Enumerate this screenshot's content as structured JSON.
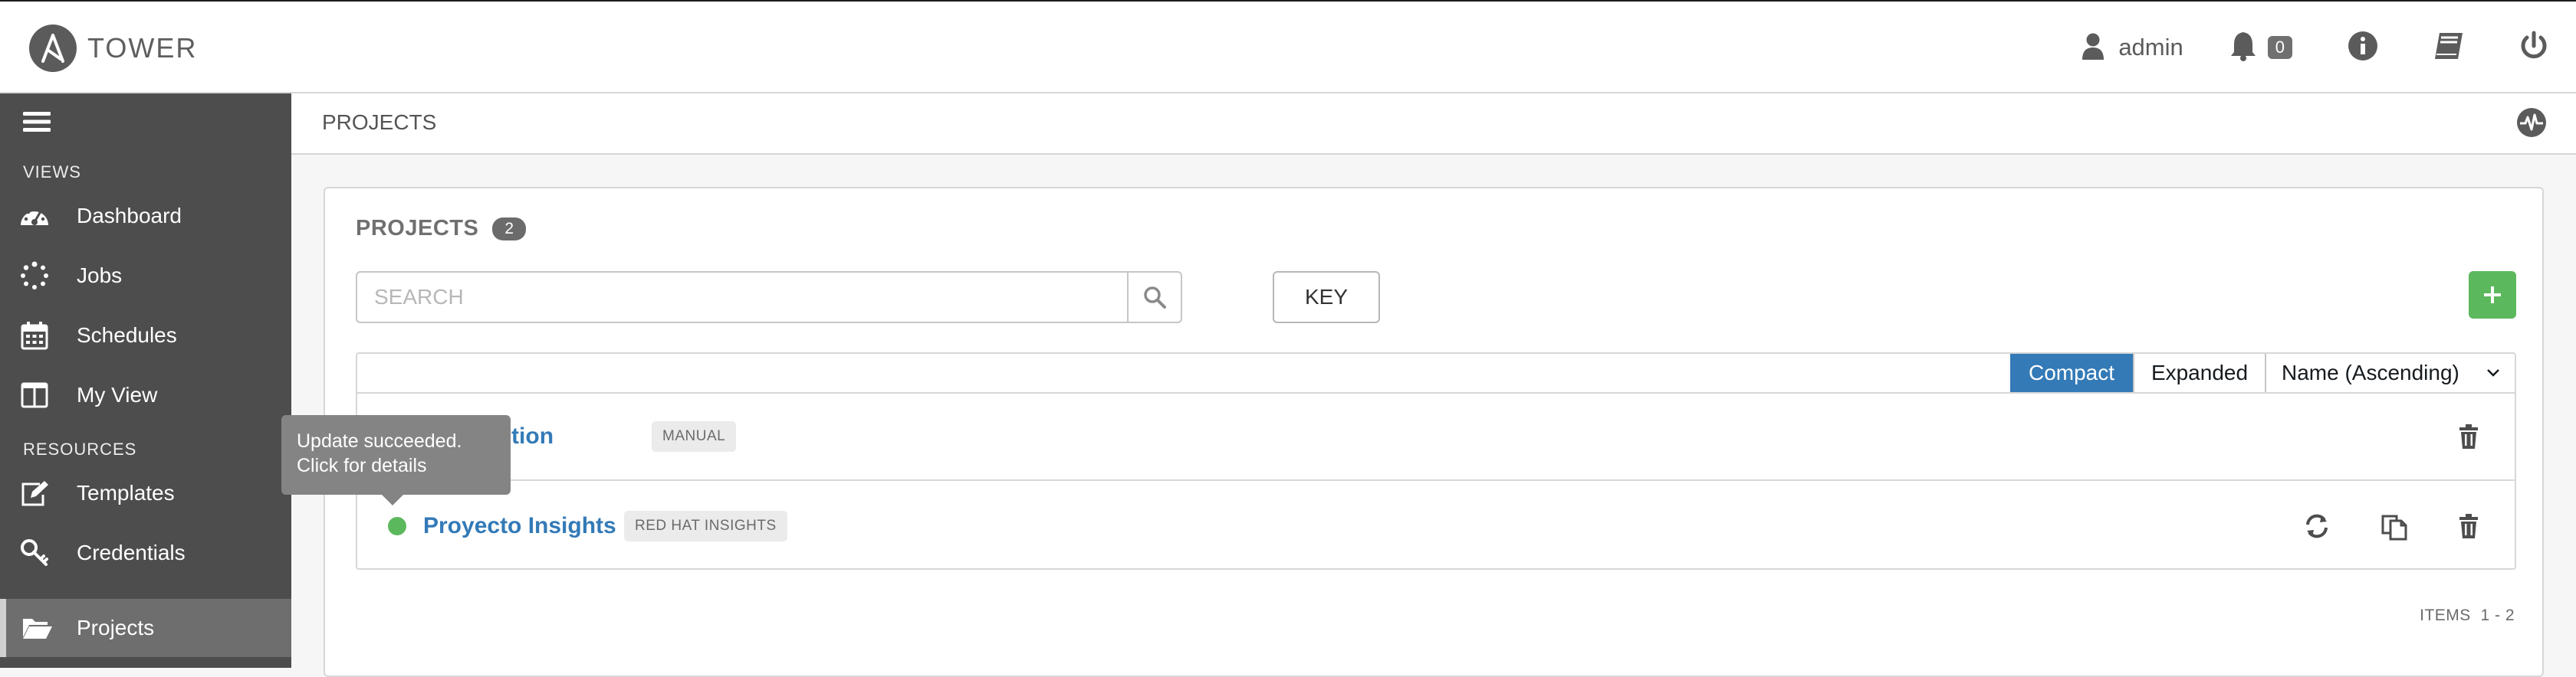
{
  "app": {
    "logo_text": "TOWER"
  },
  "header": {
    "user_label": "admin",
    "notifications_count": "0"
  },
  "sidebar": {
    "sections": {
      "views": "VIEWS",
      "resources": "RESOURCES"
    },
    "items": [
      {
        "label": "Dashboard",
        "icon": "dashboard-icon"
      },
      {
        "label": "Jobs",
        "icon": "spinner-icon"
      },
      {
        "label": "Schedules",
        "icon": "calendar-icon"
      },
      {
        "label": "My View",
        "icon": "columns-icon"
      },
      {
        "label": "Templates",
        "icon": "edit-icon"
      },
      {
        "label": "Credentials",
        "icon": "key-icon"
      },
      {
        "label": "Projects",
        "icon": "folder-open-icon",
        "active": true
      }
    ]
  },
  "breadcrumb": {
    "current": "PROJECTS"
  },
  "panel": {
    "title": "PROJECTS",
    "count": "2",
    "search_placeholder": "SEARCH",
    "key_label": "KEY",
    "add_label": "+"
  },
  "list": {
    "view_options": {
      "compact": "Compact",
      "expanded": "Expanded",
      "active": "compact"
    },
    "sort_label": "Name (Ascending)",
    "rows": [
      {
        "name": "Demo Project Network Collection",
        "name_visible": "k Collection",
        "type": "MANUAL",
        "status": "success"
      },
      {
        "name": "Proyecto Insights",
        "type": "RED HAT INSIGHTS",
        "status": "success"
      }
    ],
    "items_label": "ITEMS  1 - 2"
  },
  "tooltip": {
    "line1": "Update succeeded.",
    "line2": "Click for details"
  },
  "colors": {
    "sidebar_bg": "#4d4d4d",
    "sidebar_active": "#6e6e6e",
    "link": "#337ab7",
    "success": "#5cb85c",
    "compact_active": "#337ab7"
  }
}
